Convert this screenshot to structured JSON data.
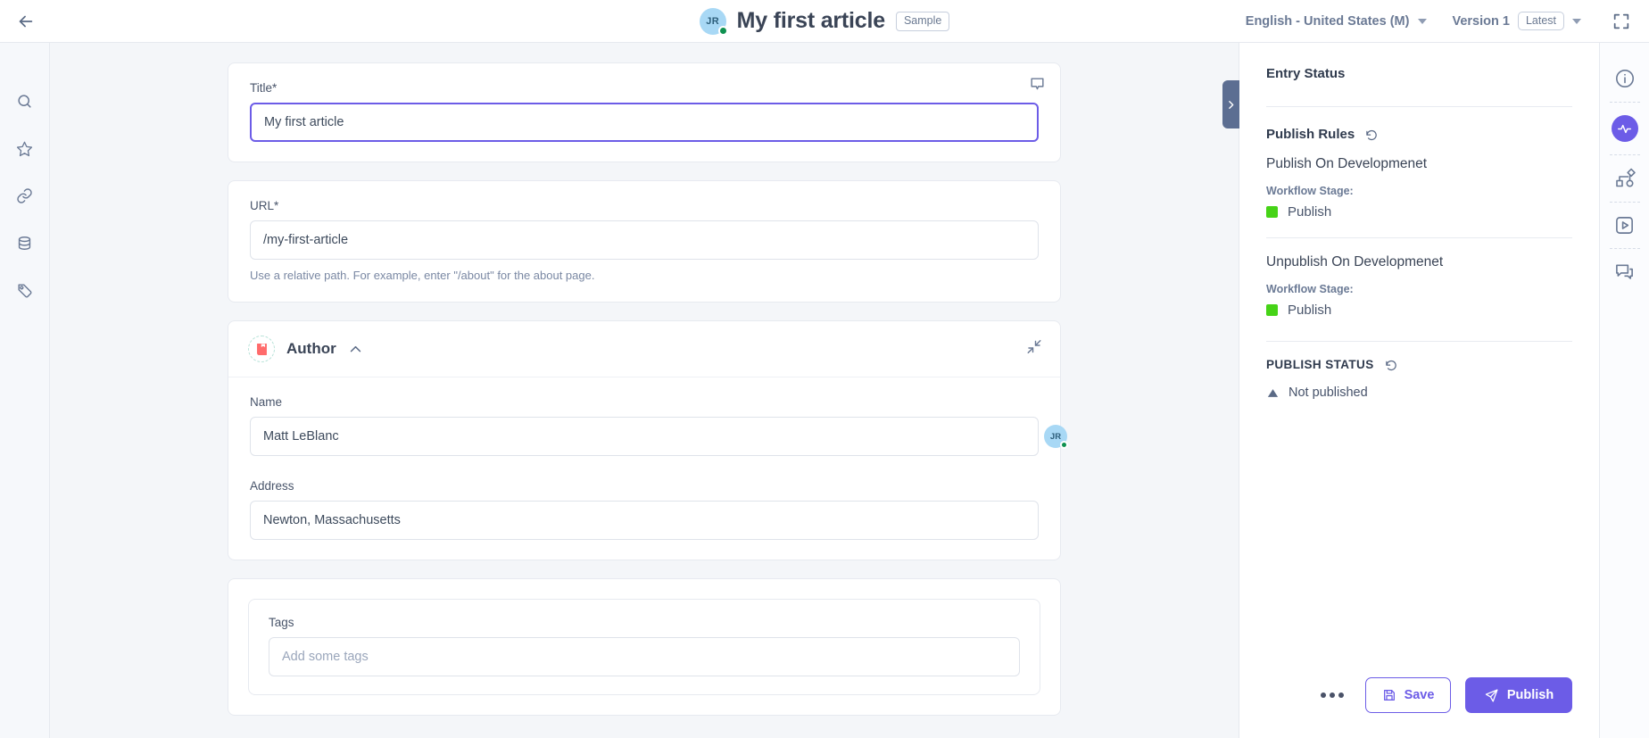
{
  "header": {
    "back_icon": "arrow-left-icon",
    "avatar_initials": "JR",
    "title": "My first article",
    "sample_badge": "Sample",
    "locale": "English - United States (M)",
    "version": "Version 1",
    "latest_badge": "Latest",
    "fullscreen_icon": "fullscreen-icon"
  },
  "left_rail": {
    "items": [
      {
        "icon": "search-icon"
      },
      {
        "icon": "star-icon"
      },
      {
        "icon": "link-icon"
      },
      {
        "icon": "database-icon"
      },
      {
        "icon": "tag-location-icon"
      }
    ]
  },
  "form": {
    "title_field": {
      "label": "Title*",
      "value": "My first article",
      "placeholder": "",
      "comment_icon": "comment-icon"
    },
    "url_field": {
      "label": "URL*",
      "value": "/my-first-article",
      "placeholder": "",
      "hint": "Use a relative path. For example, enter \"/about\" for the about page."
    },
    "author_section": {
      "icon": "book-icon",
      "title": "Author",
      "collapse_icon": "chevron-up-icon",
      "shrink_icon": "shrink-icon",
      "name_field": {
        "label": "Name",
        "value": "Matt LeBlanc",
        "avatar_initials": "JR"
      },
      "address_field": {
        "label": "Address",
        "value": "Newton, Massachusetts"
      }
    },
    "tags_field": {
      "label": "Tags",
      "value": "",
      "placeholder": "Add some tags"
    }
  },
  "right_panel": {
    "handle_icon": "chevron-right-icon",
    "title": "Entry Status",
    "publish_rules": {
      "heading": "Publish Rules",
      "undo_icon": "undo-icon",
      "rules": [
        {
          "name": "Publish On Developmenet",
          "stage_label": "Workflow Stage:",
          "stage_value": "Publish",
          "stage_color": "#46d317"
        },
        {
          "name": "Unpublish On Developmenet",
          "stage_label": "Workflow Stage:",
          "stage_value": "Publish",
          "stage_color": "#46d317"
        }
      ]
    },
    "publish_status": {
      "heading": "PUBLISH STATUS",
      "undo_icon": "undo-icon",
      "status_icon": "triangle-icon",
      "status_text": "Not published"
    },
    "footer": {
      "more_icon": "more-dots-icon",
      "save_label": "Save",
      "save_icon": "floppy-disk-icon",
      "publish_label": "Publish",
      "publish_icon": "paper-plane-icon"
    }
  },
  "right_rail": {
    "items": [
      {
        "icon": "info-icon",
        "active": false
      },
      {
        "icon": "activity-pulse-icon",
        "active": true
      },
      {
        "icon": "workflow-nodes-icon",
        "active": false
      },
      {
        "icon": "play-box-icon",
        "active": false
      },
      {
        "icon": "chat-bubbles-icon",
        "active": false
      }
    ]
  },
  "theme": {
    "accent": "#6c5ce7",
    "status_green": "#46d317",
    "panel_handle": "#5c6e92"
  }
}
